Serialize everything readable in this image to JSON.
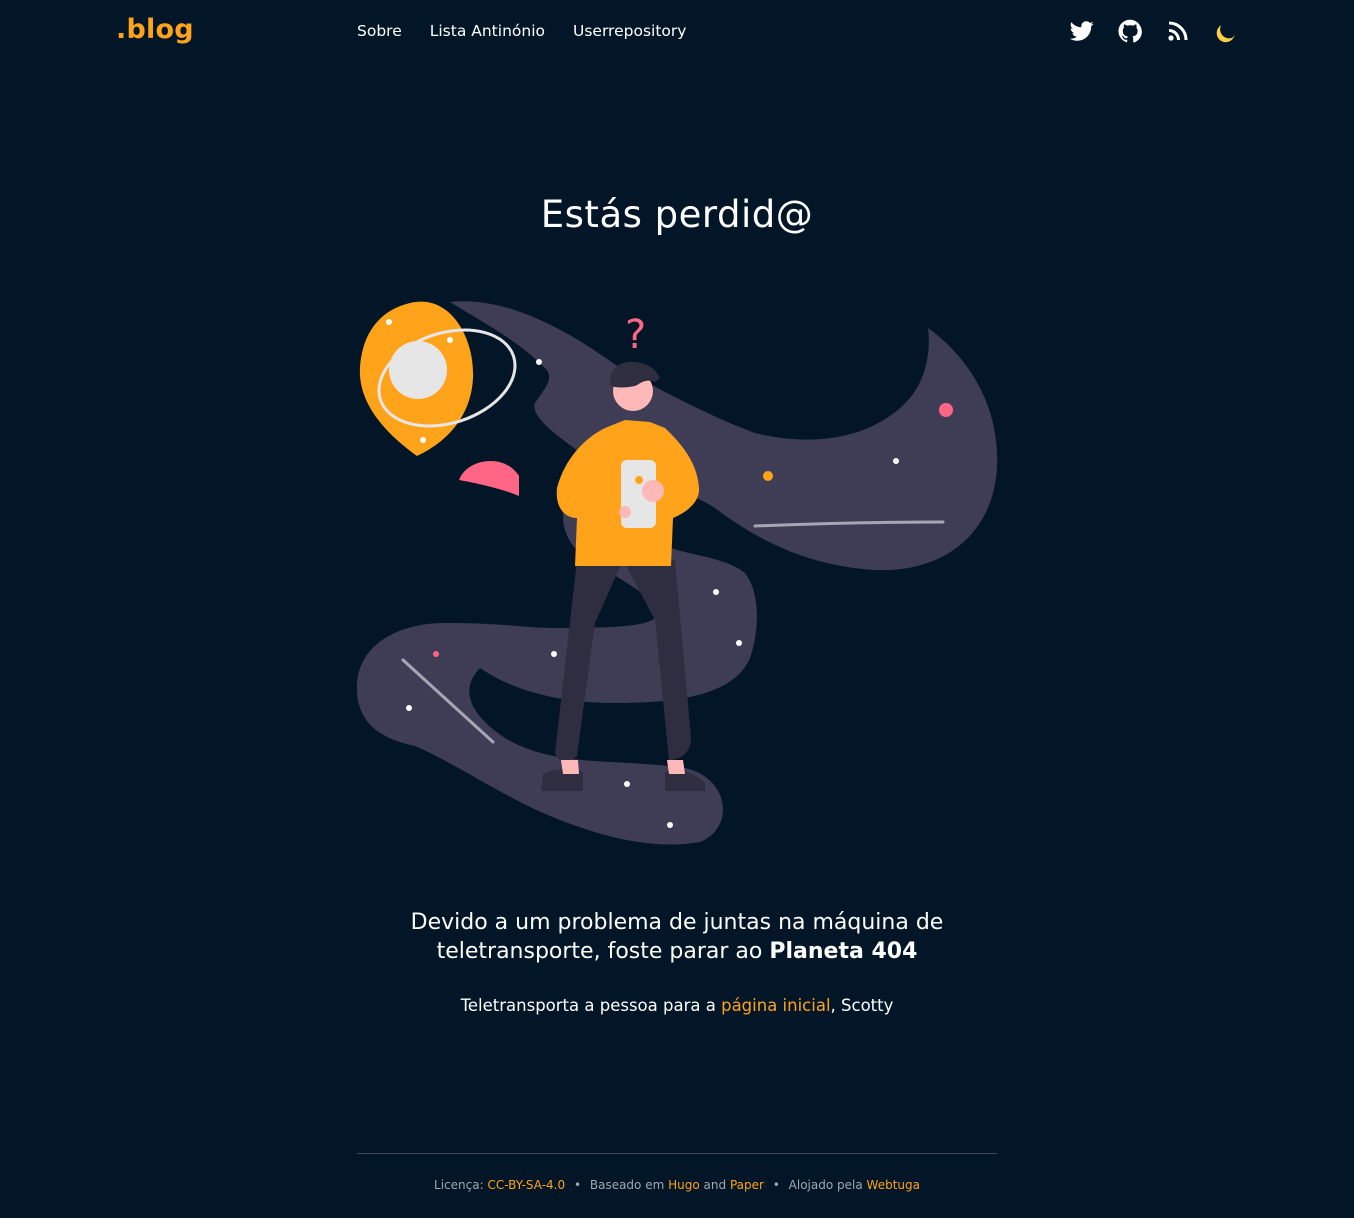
{
  "header": {
    "logo": ".blog",
    "nav": [
      {
        "label": "Sobre"
      },
      {
        "label": "Lista Antinónio"
      },
      {
        "label": "Userrepository"
      }
    ],
    "social": {
      "twitter_icon": "twitter-icon",
      "github_icon": "github-icon",
      "rss_icon": "rss-icon",
      "theme_toggle": "🌙"
    }
  },
  "main": {
    "title": "Estás perdid@",
    "illustration_alt": "question-mark",
    "message_lead": "Devido a um problema de juntas na máquina de teletransporte, foste parar ao ",
    "message_strong": "Planeta 404",
    "cta_before": "Teletransporta a pessoa para a ",
    "cta_link": "página inicial",
    "cta_after": ", Scotty"
  },
  "footer": {
    "license_label": "Licença:",
    "license_link": "CC-BY-SA-4.0",
    "sep1": "•",
    "based_label": "Baseado em",
    "hugo_link": "Hugo",
    "and_text": "and",
    "paper_link": "Paper",
    "sep2": "•",
    "hosted_label": "Alojado pela",
    "webtuga_link": "Webtuga"
  },
  "colors": {
    "background": "#021627",
    "accent": "#ffa31a",
    "nebula": "#3f3d56",
    "pink": "#ff6584"
  }
}
